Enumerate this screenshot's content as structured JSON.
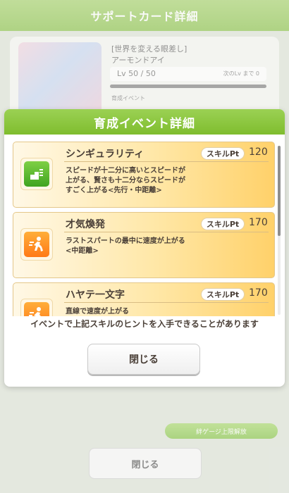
{
  "background": {
    "header_title": "サポートカード詳細",
    "card_name_line1": "[世界を変える眼差し]",
    "card_name_line2": "アーモンドアイ",
    "card_level": "Lv 50 / 50",
    "card_level_note": "次のLv まで 0",
    "card_sub": "育成イベント",
    "pill_button_label": "絆ゲージ上限解放",
    "close_label": "閉じる"
  },
  "modal": {
    "title": "育成イベント詳細",
    "skills": [
      {
        "name": "シンギュラリティ",
        "badge": "スキルPt",
        "pt": "120",
        "desc_lines": [
          "スピードが十二分に高いとスピードが",
          "上がる、賢さも十二分ならスピードが",
          "すごく上がる<先行・中距離>"
        ],
        "icon": "speed-boost-icon",
        "icon_color": "#4fb12a"
      },
      {
        "name": "才気煥発",
        "badge": "スキルPt",
        "pt": "170",
        "desc_lines": [
          "ラストスパートの最中に速度が上がる",
          "<中距離>"
        ],
        "icon": "runner-icon",
        "icon_color": "#ff8a1f"
      },
      {
        "name": "ハヤテ一文字",
        "badge": "スキルPt",
        "pt": "170",
        "desc_lines": [
          "直線で速度が上がる"
        ],
        "icon": "runner-icon",
        "icon_color": "#ff8a1f"
      }
    ],
    "notice": "イベントで上記スキルのヒントを入手できることがあります",
    "close_label": "閉じる"
  },
  "scroll_position": 0.0
}
